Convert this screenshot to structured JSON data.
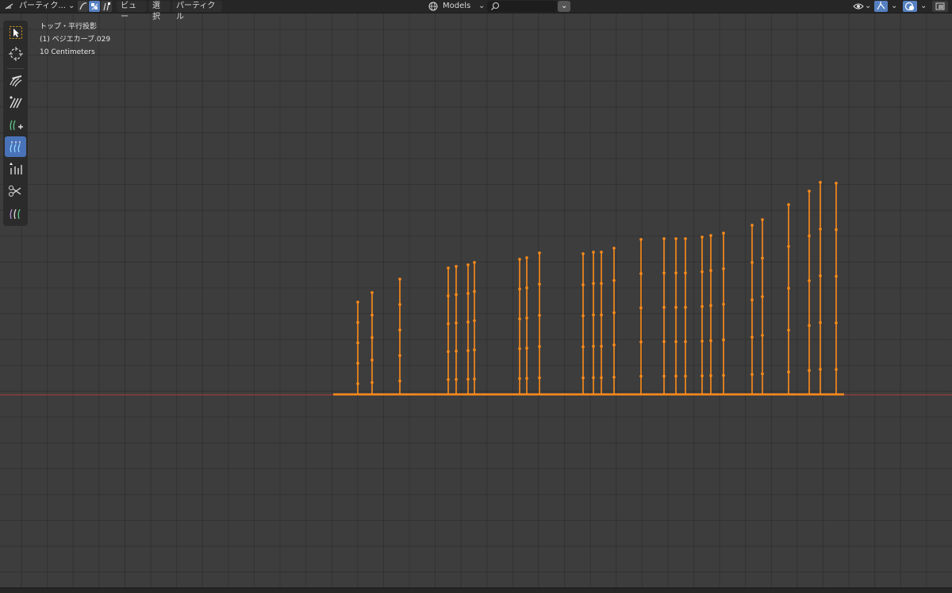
{
  "header": {
    "mode_label": "パーティク...",
    "menu": [
      "ビュー",
      "選択",
      "パーティクル"
    ],
    "collection_label": "Models",
    "search_value": ""
  },
  "overlay": {
    "view_name": "トップ・平行投影",
    "object_name": "(1) ベジエカーブ.029",
    "scale": "10 Centimeters"
  },
  "tools": [
    {
      "icon": "select-cursor-icon",
      "active": false
    },
    {
      "icon": "cursor-3d-icon",
      "active": false
    },
    {
      "icon": "comb-icon",
      "active": false
    },
    {
      "icon": "smooth-icon",
      "active": false
    },
    {
      "icon": "add-hair-icon",
      "active": false
    },
    {
      "icon": "length-icon",
      "active": true
    },
    {
      "icon": "puff-icon",
      "active": false
    },
    {
      "icon": "cut-icon",
      "active": false
    },
    {
      "icon": "weight-icon",
      "active": false
    }
  ],
  "colors": {
    "curve": "#ff8c1a",
    "axis": "#b83a3a",
    "active_tool": "#4a72b8",
    "background": "#3d3d3d"
  }
}
